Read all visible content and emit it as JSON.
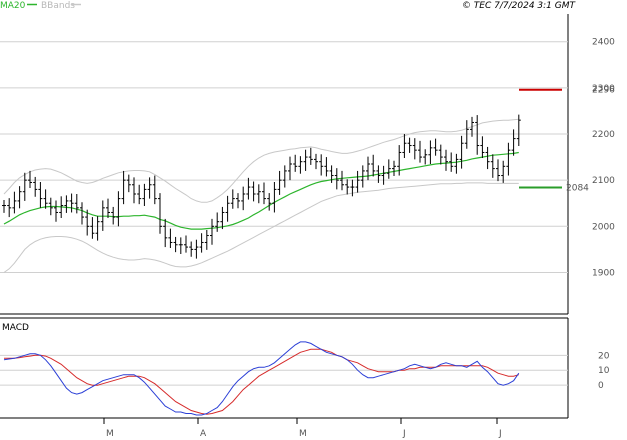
{
  "header": {
    "legend": [
      {
        "name": "MA20",
        "color": "#2db52d"
      },
      {
        "name": "BBands",
        "color": "#c8c8c8"
      }
    ],
    "copyright": "© TEC 7/7/2024 3:1 GMT"
  },
  "colors": {
    "price_bars": "#000000",
    "ma20": "#2db52d",
    "bbands": "#c8c8c8",
    "resistance": "#cc0000",
    "support": "#2a9d2a",
    "macd_line": "#2b3fd6",
    "signal_line": "#d62b2b",
    "grid": "#d0d0d0"
  },
  "chart_data": [
    {
      "type": "ohlc",
      "title": "",
      "ylim": [
        1810,
        2460
      ],
      "yticks": [
        "2400",
        "2300",
        "2200",
        "2100",
        "2000",
        "1900"
      ],
      "x_months": [
        "M",
        "A",
        "M",
        "J",
        "J"
      ],
      "levels": [
        {
          "label": "2296",
          "value": 2296,
          "color": "#cc0000"
        },
        {
          "label": "2084",
          "value": 2084,
          "color": "#2a9d2a"
        }
      ],
      "series": [
        {
          "name": "Price",
          "values": [
            2045,
            2040,
            2055,
            2075,
            2100,
            2095,
            2080,
            2060,
            2050,
            2040,
            2030,
            2045,
            2055,
            2050,
            2040,
            2020,
            2000,
            1985,
            2010,
            2040,
            2030,
            2020,
            2060,
            2100,
            2090,
            2070,
            2060,
            2080,
            2090,
            2060,
            2000,
            1975,
            1965,
            1960,
            1960,
            1955,
            1950,
            1955,
            1965,
            1980,
            2000,
            2010,
            2030,
            2050,
            2060,
            2055,
            2070,
            2085,
            2070,
            2075,
            2060,
            2050,
            2080,
            2100,
            2120,
            2135,
            2130,
            2140,
            2150,
            2145,
            2140,
            2130,
            2120,
            2110,
            2100,
            2090,
            2085,
            2085,
            2100,
            2120,
            2135,
            2120,
            2110,
            2115,
            2125,
            2130,
            2160,
            2180,
            2175,
            2165,
            2150,
            2155,
            2170,
            2165,
            2150,
            2140,
            2130,
            2145,
            2180,
            2210,
            2225,
            2175,
            2160,
            2140,
            2125,
            2110,
            2130,
            2165,
            2190,
            2230
          ]
        },
        {
          "name": "MA20",
          "values": [
            2005,
            2011,
            2018,
            2025,
            2030,
            2034,
            2037,
            2040,
            2042,
            2043,
            2043,
            2042,
            2041,
            2040,
            2037,
            2034,
            2029,
            2025,
            2022,
            2022,
            2022,
            2021,
            2021,
            2022,
            2022,
            2023,
            2023,
            2024,
            2022,
            2020,
            2015,
            2012,
            2007,
            2002,
            1998,
            1996,
            1994,
            1994,
            1994,
            1995,
            1996,
            1997,
            1999,
            2001,
            2004,
            2008,
            2013,
            2018,
            2025,
            2031,
            2038,
            2045,
            2052,
            2058,
            2064,
            2070,
            2075,
            2080,
            2085,
            2090,
            2094,
            2097,
            2099,
            2101,
            2103,
            2104,
            2105,
            2106,
            2107,
            2108,
            2109,
            2111,
            2113,
            2115,
            2117,
            2119,
            2121,
            2123,
            2125,
            2127,
            2129,
            2131,
            2133,
            2135,
            2136,
            2137,
            2138,
            2139,
            2141,
            2143,
            2146,
            2148,
            2150,
            2152,
            2154,
            2155,
            2156,
            2157,
            2158,
            2160
          ]
        },
        {
          "name": "BBands Upper",
          "values": [
            2070,
            2082,
            2095,
            2105,
            2112,
            2118,
            2122,
            2124,
            2125,
            2124,
            2120,
            2116,
            2110,
            2104,
            2098,
            2095,
            2093,
            2095,
            2099,
            2104,
            2108,
            2112,
            2116,
            2118,
            2120,
            2121,
            2121,
            2120,
            2118,
            2112,
            2105,
            2098,
            2090,
            2082,
            2075,
            2068,
            2060,
            2055,
            2052,
            2052,
            2055,
            2062,
            2070,
            2080,
            2092,
            2105,
            2118,
            2130,
            2140,
            2148,
            2154,
            2158,
            2161,
            2163,
            2165,
            2167,
            2168,
            2170,
            2171,
            2172,
            2170,
            2167,
            2165,
            2162,
            2160,
            2158,
            2158,
            2160,
            2163,
            2166,
            2170,
            2174,
            2178,
            2182,
            2185,
            2188,
            2192,
            2196,
            2200,
            2203,
            2205,
            2206,
            2207,
            2207,
            2206,
            2205,
            2205,
            2206,
            2208,
            2212,
            2216,
            2220,
            2224,
            2226,
            2228,
            2229,
            2230,
            2230,
            2231,
            2232
          ]
        },
        {
          "name": "BBands Lower",
          "values": [
            1900,
            1908,
            1920,
            1935,
            1950,
            1960,
            1967,
            1972,
            1975,
            1977,
            1978,
            1978,
            1977,
            1975,
            1972,
            1968,
            1962,
            1955,
            1948,
            1942,
            1937,
            1933,
            1930,
            1928,
            1927,
            1927,
            1928,
            1930,
            1929,
            1927,
            1924,
            1920,
            1916,
            1913,
            1912,
            1912,
            1914,
            1917,
            1921,
            1926,
            1931,
            1936,
            1941,
            1946,
            1952,
            1958,
            1964,
            1970,
            1976,
            1982,
            1988,
            1994,
            2000,
            2006,
            2012,
            2018,
            2024,
            2030,
            2036,
            2042,
            2048,
            2054,
            2058,
            2062,
            2066,
            2068,
            2070,
            2072,
            2074,
            2075,
            2076,
            2077,
            2078,
            2080,
            2082,
            2083,
            2084,
            2085,
            2086,
            2087,
            2088,
            2089,
            2090,
            2091,
            2092,
            2092,
            2092,
            2093,
            2093,
            2094,
            2094,
            2094,
            2094,
            2093,
            2093,
            2093,
            2093,
            2093,
            2093,
            2093
          ]
        }
      ]
    },
    {
      "type": "line",
      "title": "MACD",
      "ylim": [
        -22,
        45
      ],
      "yticks": [
        "20",
        "10",
        "0"
      ],
      "series": [
        {
          "name": "MACD",
          "values": [
            17,
            17.5,
            18,
            19,
            20,
            21,
            21,
            20,
            17,
            13,
            8,
            3,
            -2,
            -5,
            -6,
            -5,
            -3,
            -1,
            1,
            3,
            4,
            5,
            6,
            7,
            7,
            7,
            5,
            2,
            -2,
            -6,
            -10,
            -14,
            -16,
            -18,
            -18,
            -19,
            -19,
            -20,
            -20,
            -19,
            -17,
            -15,
            -11,
            -6,
            -1,
            3,
            6,
            9,
            11,
            12,
            12,
            13,
            15,
            18,
            21,
            24,
            27,
            29,
            29,
            28,
            26,
            24,
            22,
            21,
            20,
            19,
            17,
            14,
            10,
            7,
            5,
            5,
            6,
            7,
            8,
            9,
            10,
            11,
            13,
            14,
            13,
            12,
            11,
            12,
            14,
            15,
            14,
            13,
            13,
            12,
            14,
            16,
            12,
            9,
            5,
            1,
            0,
            1,
            3,
            8
          ]
        },
        {
          "name": "Signal",
          "values": [
            18,
            18,
            18,
            18.5,
            19,
            19.5,
            20,
            20,
            19.5,
            18,
            16,
            14,
            11,
            8,
            5,
            3,
            1,
            0,
            0,
            1,
            2,
            3,
            4,
            5,
            6,
            6,
            6,
            5,
            3,
            1,
            -2,
            -5,
            -8,
            -11,
            -13,
            -15,
            -17,
            -18,
            -19,
            -19.5,
            -19,
            -18,
            -17,
            -14,
            -11,
            -7,
            -3,
            0,
            3,
            6,
            8,
            10,
            12,
            14,
            16,
            18,
            20,
            22,
            23,
            24,
            24,
            24,
            23,
            22,
            20,
            19,
            17,
            16,
            15,
            13,
            11,
            10,
            9,
            9,
            9,
            9,
            10,
            10,
            11,
            11,
            12,
            12,
            12,
            12,
            13,
            13,
            13,
            13,
            13,
            13,
            13,
            13,
            13,
            12,
            10,
            8,
            7,
            6,
            6,
            7
          ]
        }
      ]
    }
  ]
}
